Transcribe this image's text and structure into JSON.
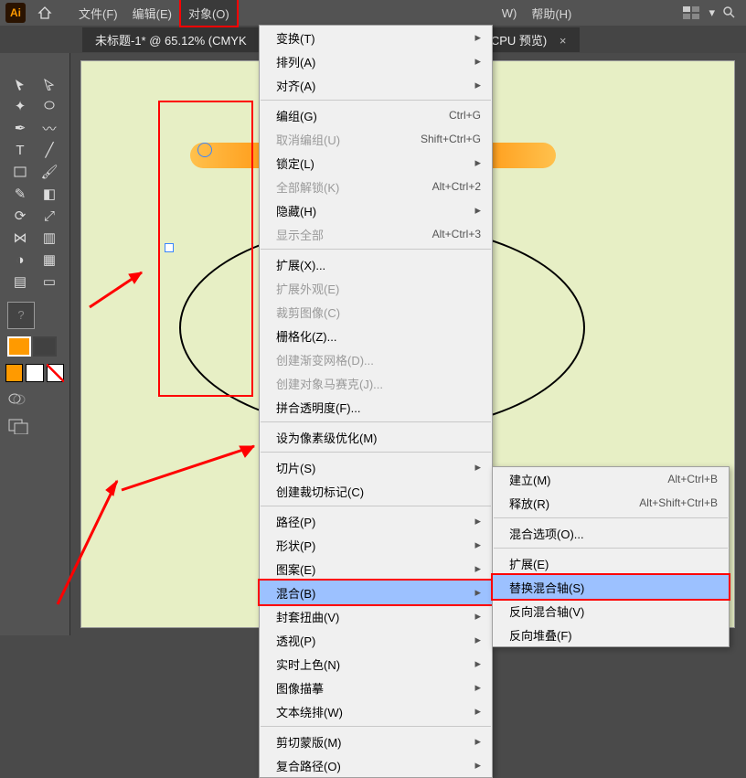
{
  "app": {
    "logo": "Ai"
  },
  "menubar": {
    "items": [
      {
        "label": "文件(F)"
      },
      {
        "label": "编辑(E)"
      },
      {
        "label": "对象(O)"
      },
      {
        "label": "W)"
      },
      {
        "label": "帮助(H)"
      }
    ]
  },
  "tab": {
    "title": "未标题-1* @ 65.12% (CMYK",
    "suffix": "/CPU 预览)",
    "close": "×"
  },
  "object_menu": {
    "groups": [
      [
        {
          "label": "变换(T)",
          "sub": true
        },
        {
          "label": "排列(A)",
          "sub": true
        },
        {
          "label": "对齐(A)",
          "sub": true
        }
      ],
      [
        {
          "label": "编组(G)",
          "kb": "Ctrl+G"
        },
        {
          "label": "取消编组(U)",
          "kb": "Shift+Ctrl+G",
          "disabled": true
        },
        {
          "label": "锁定(L)",
          "sub": true
        },
        {
          "label": "全部解锁(K)",
          "kb": "Alt+Ctrl+2",
          "disabled": true
        },
        {
          "label": "隐藏(H)",
          "sub": true
        },
        {
          "label": "显示全部",
          "kb": "Alt+Ctrl+3",
          "disabled": true
        }
      ],
      [
        {
          "label": "扩展(X)..."
        },
        {
          "label": "扩展外观(E)",
          "disabled": true
        },
        {
          "label": "裁剪图像(C)",
          "disabled": true
        },
        {
          "label": "栅格化(Z)..."
        },
        {
          "label": "创建渐变网格(D)...",
          "disabled": true
        },
        {
          "label": "创建对象马赛克(J)...",
          "disabled": true
        },
        {
          "label": "拼合透明度(F)..."
        }
      ],
      [
        {
          "label": "设为像素级优化(M)"
        }
      ],
      [
        {
          "label": "切片(S)",
          "sub": true
        },
        {
          "label": "创建裁切标记(C)"
        }
      ],
      [
        {
          "label": "路径(P)",
          "sub": true
        },
        {
          "label": "形状(P)",
          "sub": true
        },
        {
          "label": "图案(E)",
          "sub": true
        },
        {
          "label": "混合(B)",
          "sub": true,
          "hl": true,
          "red": true
        },
        {
          "label": "封套扭曲(V)",
          "sub": true
        },
        {
          "label": "透视(P)",
          "sub": true
        },
        {
          "label": "实时上色(N)",
          "sub": true
        },
        {
          "label": "图像描摹",
          "sub": true
        },
        {
          "label": "文本绕排(W)",
          "sub": true
        }
      ],
      [
        {
          "label": "剪切蒙版(M)",
          "sub": true
        },
        {
          "label": "复合路径(O)",
          "sub": true
        }
      ]
    ]
  },
  "blend_submenu": {
    "items": [
      {
        "label": "建立(M)",
        "kb": "Alt+Ctrl+B"
      },
      {
        "label": "释放(R)",
        "kb": "Alt+Shift+Ctrl+B"
      },
      {
        "sep": true
      },
      {
        "label": "混合选项(O)..."
      },
      {
        "sep": true
      },
      {
        "label": "扩展(E)"
      },
      {
        "label": "替换混合轴(S)",
        "hl": true,
        "red": true
      },
      {
        "label": "反向混合轴(V)"
      },
      {
        "label": "反向堆叠(F)"
      }
    ]
  },
  "icons": {
    "home": "⌂",
    "arrow": "▸",
    "search": "⌕"
  }
}
